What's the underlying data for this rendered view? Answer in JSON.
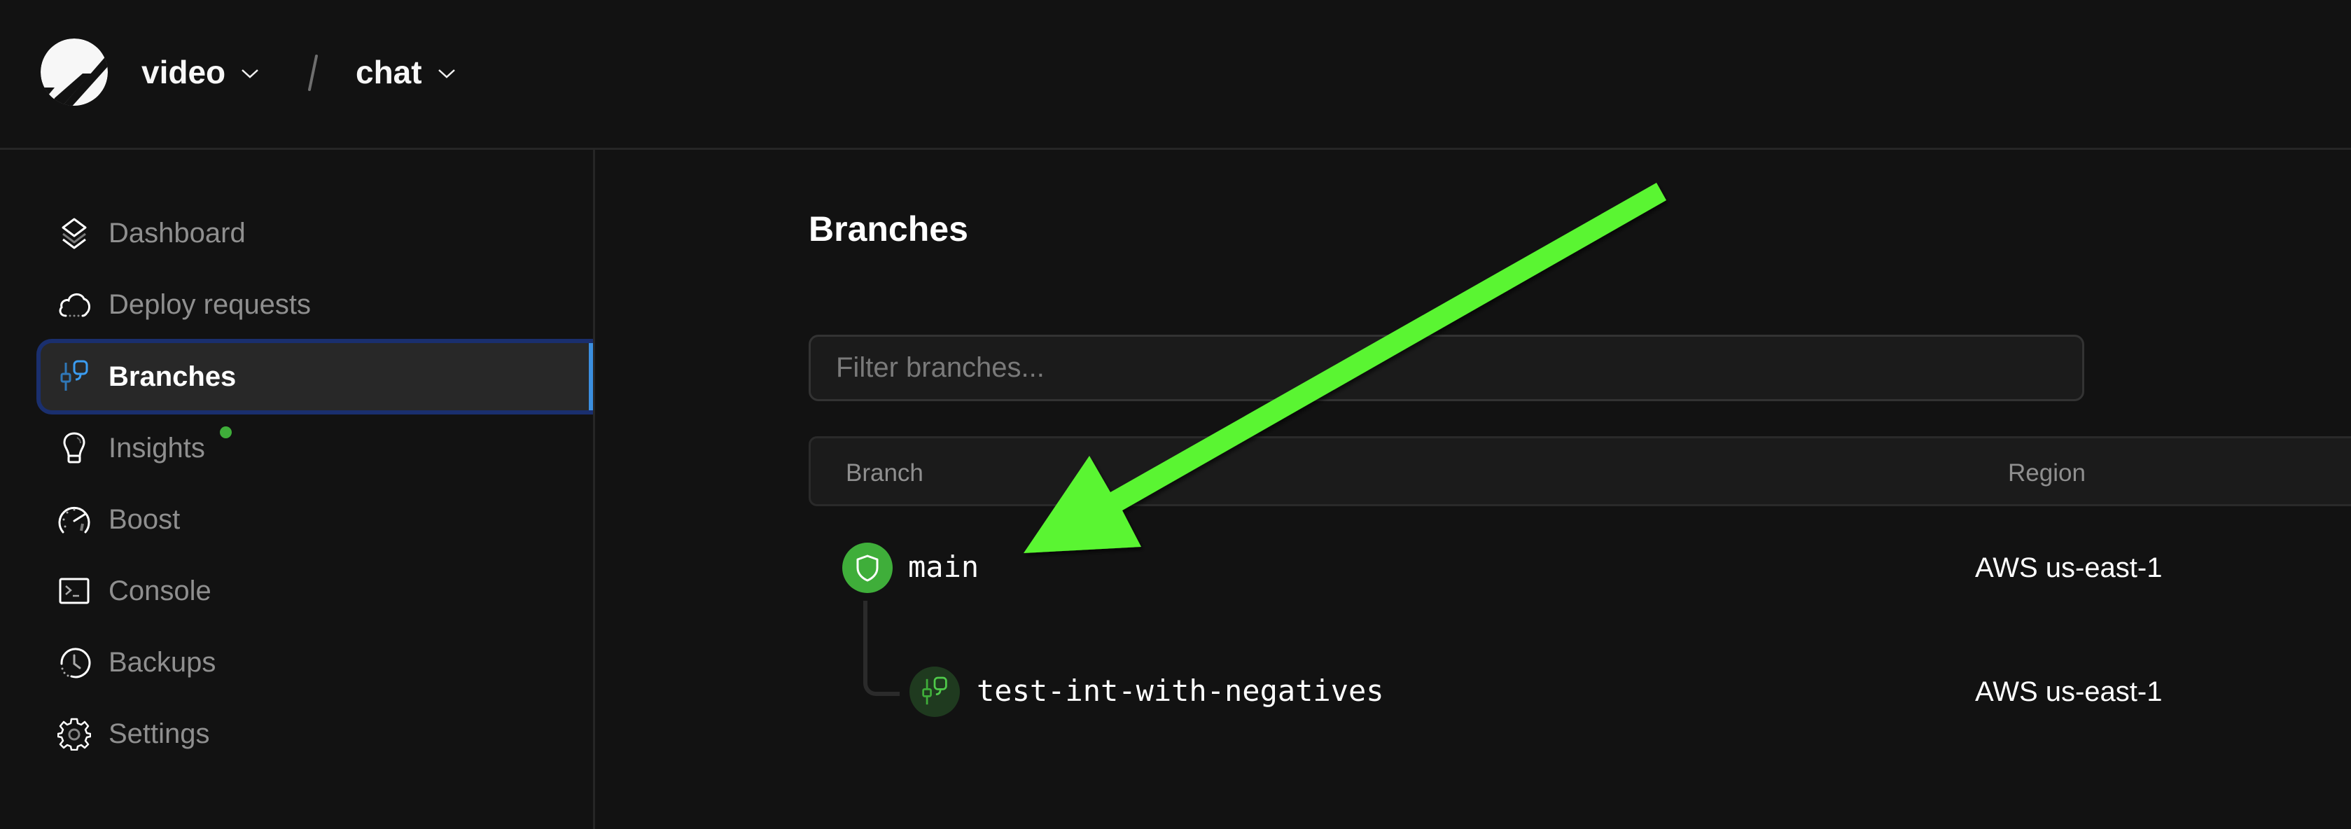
{
  "header": {
    "org_name": "video",
    "database_name": "chat",
    "separator": "/"
  },
  "sidebar": {
    "items": [
      {
        "label": "Dashboard",
        "icon": "layers-icon",
        "active": false
      },
      {
        "label": "Deploy requests",
        "icon": "cloud-icon",
        "active": false
      },
      {
        "label": "Branches",
        "icon": "branch-icon",
        "active": true
      },
      {
        "label": "Insights",
        "icon": "lightbulb-icon",
        "active": false,
        "has_notification": true
      },
      {
        "label": "Boost",
        "icon": "speedometer-icon",
        "active": false
      },
      {
        "label": "Console",
        "icon": "terminal-icon",
        "active": false
      },
      {
        "label": "Backups",
        "icon": "clock-icon",
        "active": false
      },
      {
        "label": "Settings",
        "icon": "gear-icon",
        "active": false
      }
    ]
  },
  "main": {
    "title": "Branches",
    "filter": {
      "placeholder": "Filter branches...",
      "value": ""
    },
    "table": {
      "columns": [
        "Branch",
        "Region"
      ],
      "rows": [
        {
          "name": "main",
          "region": "AWS us-east-1",
          "type": "production",
          "icon": "shield-icon",
          "level": 0
        },
        {
          "name": "test-int-with-negatives",
          "region": "AWS us-east-1",
          "type": "development",
          "icon": "branch-icon",
          "level": 1
        }
      ]
    }
  },
  "annotation": {
    "type": "arrow",
    "color": "#5af532",
    "points_to": "main"
  },
  "colors": {
    "background": "#121212",
    "accent_blue": "#3b8fe0",
    "active_border": "#1a2f6e",
    "production_green": "#3fae3a",
    "dev_branch_bg": "#1f3a1f"
  }
}
